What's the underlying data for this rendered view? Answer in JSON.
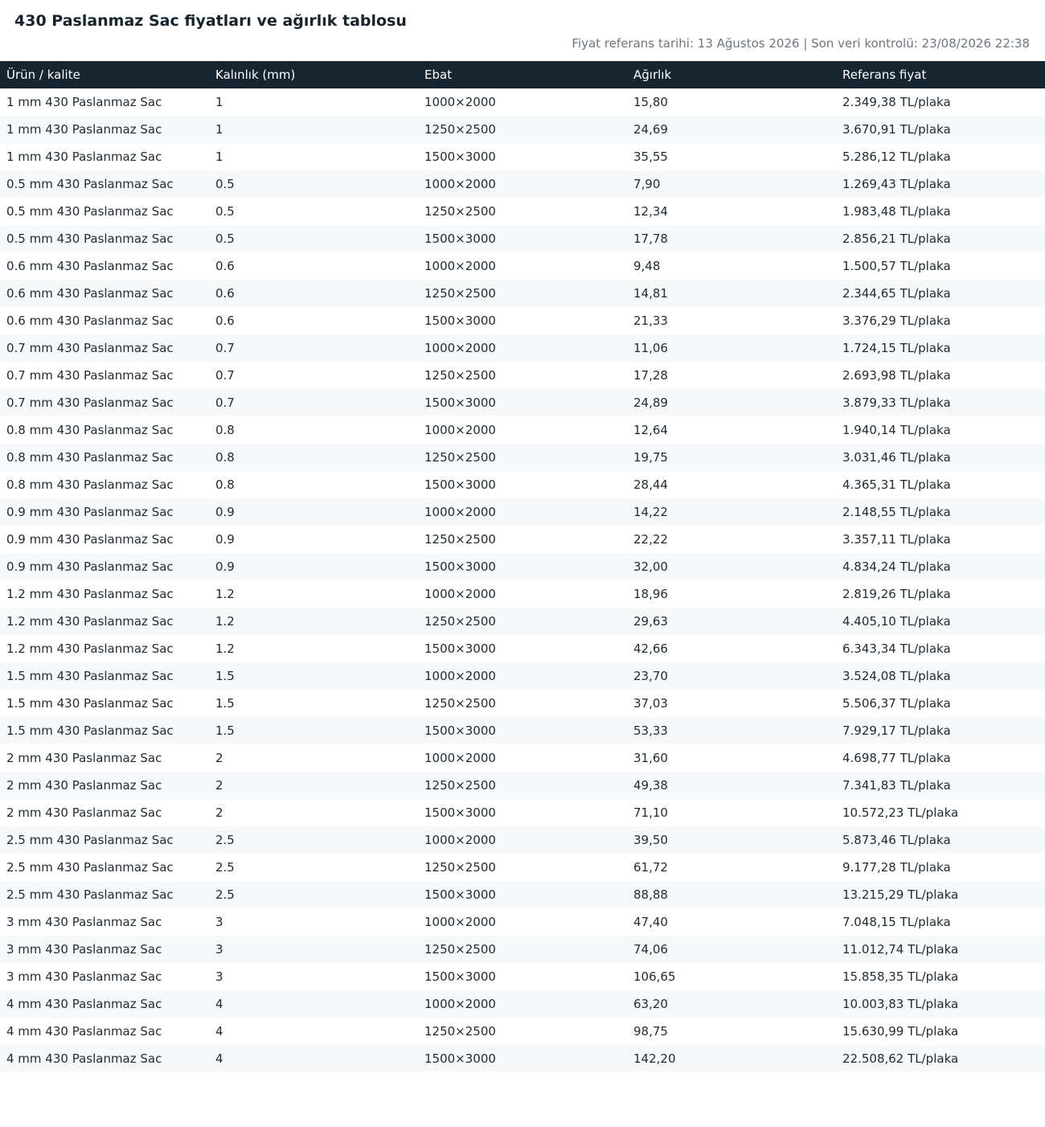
{
  "page": {
    "title": "430 Paslanmaz Sac fiyatları ve ağırlık tablosu",
    "meta": "Fiyat referans tarihi: 13 Ağustos 2026 | Son veri kontrolü: 23/08/2026 22:38"
  },
  "table": {
    "headers": [
      "Ürün / kalite",
      "Kalınlık (mm)",
      "Ebat",
      "Ağırlık",
      "Referans fiyat"
    ],
    "rows": [
      [
        "1 mm 430 Paslanmaz Sac",
        "1",
        "1000×2000",
        "15,80",
        "2.349,38 TL/plaka"
      ],
      [
        "1 mm 430 Paslanmaz Sac",
        "1",
        "1250×2500",
        "24,69",
        "3.670,91 TL/plaka"
      ],
      [
        "1 mm 430 Paslanmaz Sac",
        "1",
        "1500×3000",
        "35,55",
        "5.286,12 TL/plaka"
      ],
      [
        "0.5 mm 430 Paslanmaz Sac",
        "0.5",
        "1000×2000",
        "7,90",
        "1.269,43 TL/plaka"
      ],
      [
        "0.5 mm 430 Paslanmaz Sac",
        "0.5",
        "1250×2500",
        "12,34",
        "1.983,48 TL/plaka"
      ],
      [
        "0.5 mm 430 Paslanmaz Sac",
        "0.5",
        "1500×3000",
        "17,78",
        "2.856,21 TL/plaka"
      ],
      [
        "0.6 mm 430 Paslanmaz Sac",
        "0.6",
        "1000×2000",
        "9,48",
        "1.500,57 TL/plaka"
      ],
      [
        "0.6 mm 430 Paslanmaz Sac",
        "0.6",
        "1250×2500",
        "14,81",
        "2.344,65 TL/plaka"
      ],
      [
        "0.6 mm 430 Paslanmaz Sac",
        "0.6",
        "1500×3000",
        "21,33",
        "3.376,29 TL/plaka"
      ],
      [
        "0.7 mm 430 Paslanmaz Sac",
        "0.7",
        "1000×2000",
        "11,06",
        "1.724,15 TL/plaka"
      ],
      [
        "0.7 mm 430 Paslanmaz Sac",
        "0.7",
        "1250×2500",
        "17,28",
        "2.693,98 TL/plaka"
      ],
      [
        "0.7 mm 430 Paslanmaz Sac",
        "0.7",
        "1500×3000",
        "24,89",
        "3.879,33 TL/plaka"
      ],
      [
        "0.8 mm 430 Paslanmaz Sac",
        "0.8",
        "1000×2000",
        "12,64",
        "1.940,14 TL/plaka"
      ],
      [
        "0.8 mm 430 Paslanmaz Sac",
        "0.8",
        "1250×2500",
        "19,75",
        "3.031,46 TL/plaka"
      ],
      [
        "0.8 mm 430 Paslanmaz Sac",
        "0.8",
        "1500×3000",
        "28,44",
        "4.365,31 TL/plaka"
      ],
      [
        "0.9 mm 430 Paslanmaz Sac",
        "0.9",
        "1000×2000",
        "14,22",
        "2.148,55 TL/plaka"
      ],
      [
        "0.9 mm 430 Paslanmaz Sac",
        "0.9",
        "1250×2500",
        "22,22",
        "3.357,11 TL/plaka"
      ],
      [
        "0.9 mm 430 Paslanmaz Sac",
        "0.9",
        "1500×3000",
        "32,00",
        "4.834,24 TL/plaka"
      ],
      [
        "1.2 mm 430 Paslanmaz Sac",
        "1.2",
        "1000×2000",
        "18,96",
        "2.819,26 TL/plaka"
      ],
      [
        "1.2 mm 430 Paslanmaz Sac",
        "1.2",
        "1250×2500",
        "29,63",
        "4.405,10 TL/plaka"
      ],
      [
        "1.2 mm 430 Paslanmaz Sac",
        "1.2",
        "1500×3000",
        "42,66",
        "6.343,34 TL/plaka"
      ],
      [
        "1.5 mm 430 Paslanmaz Sac",
        "1.5",
        "1000×2000",
        "23,70",
        "3.524,08 TL/plaka"
      ],
      [
        "1.5 mm 430 Paslanmaz Sac",
        "1.5",
        "1250×2500",
        "37,03",
        "5.506,37 TL/plaka"
      ],
      [
        "1.5 mm 430 Paslanmaz Sac",
        "1.5",
        "1500×3000",
        "53,33",
        "7.929,17 TL/plaka"
      ],
      [
        "2 mm 430 Paslanmaz Sac",
        "2",
        "1000×2000",
        "31,60",
        "4.698,77 TL/plaka"
      ],
      [
        "2 mm 430 Paslanmaz Sac",
        "2",
        "1250×2500",
        "49,38",
        "7.341,83 TL/plaka"
      ],
      [
        "2 mm 430 Paslanmaz Sac",
        "2",
        "1500×3000",
        "71,10",
        "10.572,23 TL/plaka"
      ],
      [
        "2.5 mm 430 Paslanmaz Sac",
        "2.5",
        "1000×2000",
        "39,50",
        "5.873,46 TL/plaka"
      ],
      [
        "2.5 mm 430 Paslanmaz Sac",
        "2.5",
        "1250×2500",
        "61,72",
        "9.177,28 TL/plaka"
      ],
      [
        "2.5 mm 430 Paslanmaz Sac",
        "2.5",
        "1500×3000",
        "88,88",
        "13.215,29 TL/plaka"
      ],
      [
        "3 mm 430 Paslanmaz Sac",
        "3",
        "1000×2000",
        "47,40",
        "7.048,15 TL/plaka"
      ],
      [
        "3 mm 430 Paslanmaz Sac",
        "3",
        "1250×2500",
        "74,06",
        "11.012,74 TL/plaka"
      ],
      [
        "3 mm 430 Paslanmaz Sac",
        "3",
        "1500×3000",
        "106,65",
        "15.858,35 TL/plaka"
      ],
      [
        "4 mm 430 Paslanmaz Sac",
        "4",
        "1000×2000",
        "63,20",
        "10.003,83 TL/plaka"
      ],
      [
        "4 mm 430 Paslanmaz Sac",
        "4",
        "1250×2500",
        "98,75",
        "15.630,99 TL/plaka"
      ],
      [
        "4 mm 430 Paslanmaz Sac",
        "4",
        "1500×3000",
        "142,20",
        "22.508,62 TL/plaka"
      ]
    ]
  },
  "colors": {
    "header_bg": "#172531",
    "header_text": "#ffffff",
    "stripe_bg": "#f6f8fa",
    "meta_text": "#6b7680"
  }
}
